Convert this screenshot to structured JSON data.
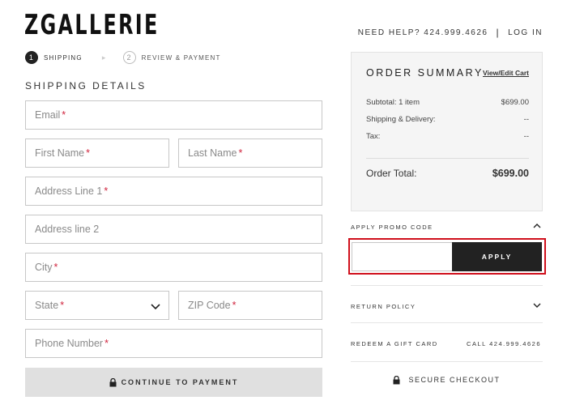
{
  "brand": {
    "logo_text": "ZGALLERIE"
  },
  "header": {
    "help_text": "NEED HELP? 424.999.4626",
    "separator": "|",
    "login_label": "LOG IN"
  },
  "steps": [
    {
      "number": "1",
      "label": "SHIPPING",
      "active": true
    },
    {
      "number": "2",
      "label": "REVIEW & PAYMENT",
      "active": false
    }
  ],
  "shipping": {
    "title": "SHIPPING DETAILS",
    "fields": {
      "email": {
        "placeholder": "Email",
        "required_mark": "*"
      },
      "first_name": {
        "placeholder": "First Name",
        "required_mark": "*"
      },
      "last_name": {
        "placeholder": "Last Name",
        "required_mark": "*"
      },
      "address1": {
        "placeholder": "Address Line 1",
        "required_mark": "*"
      },
      "address2": {
        "placeholder": "Address line 2"
      },
      "city": {
        "placeholder": "City",
        "required_mark": "*"
      },
      "state": {
        "placeholder": "State",
        "required_mark": "*"
      },
      "zip": {
        "placeholder": "ZIP Code",
        "required_mark": "*"
      },
      "phone": {
        "placeholder": "Phone Number",
        "required_mark": "*"
      }
    },
    "continue_label": "CONTINUE TO PAYMENT"
  },
  "summary": {
    "title": "ORDER SUMMARY",
    "edit_link": "View/Edit Cart",
    "rows": [
      {
        "label": "Subtotal: 1 item",
        "value": "$699.00"
      },
      {
        "label": "Shipping & Delivery:",
        "value": "--"
      },
      {
        "label": "Tax:",
        "value": "--"
      }
    ],
    "total_label": "Order Total:",
    "total_value": "$699.00"
  },
  "promo": {
    "label": "APPLY PROMO CODE",
    "input_value": "",
    "apply_label": "APPLY"
  },
  "return_policy": {
    "label": "RETURN POLICY"
  },
  "gift_card": {
    "label": "REDEEM A GIFT CARD",
    "call_text": "CALL 424.999.4626"
  },
  "secure": {
    "label": "SECURE CHECKOUT"
  },
  "colors": {
    "required": "#d0253e",
    "highlight": "#d0101c",
    "dark_button": "#222222"
  },
  "icons": [
    "lock-icon",
    "chevron-down-icon",
    "chevron-up-icon",
    "chevron-right-icon"
  ]
}
